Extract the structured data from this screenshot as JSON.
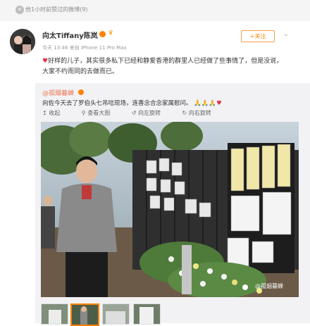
{
  "topbar": {
    "recommend_text": "他1小时前赞过的微博(9)"
  },
  "author": {
    "name": "向太Tiffany陈岚",
    "meta": "今天 13:46 来自 iPhone 11 Pro Max",
    "follow_label": "+关注",
    "post_text": "好样的儿子，其实很多私下已经和静爱香港的群里人已经做了些事情了，但是没说，大家不约而同的去做而已。"
  },
  "repost": {
    "author_prefix": "@孤烟暮蝉",
    "text": "向佐今天去了罗伯头七吊唁现场，连香念合念家属慰问。",
    "tools": {
      "collapse": "收起",
      "view_large": "查看大图",
      "rotate_left": "向左旋转",
      "rotate_right": "向右旋转"
    },
    "watermark": "@孤烟暮蝉"
  },
  "colors": {
    "accent": "#ff8200",
    "link": "#eb7350",
    "heart": "#e0334b"
  }
}
